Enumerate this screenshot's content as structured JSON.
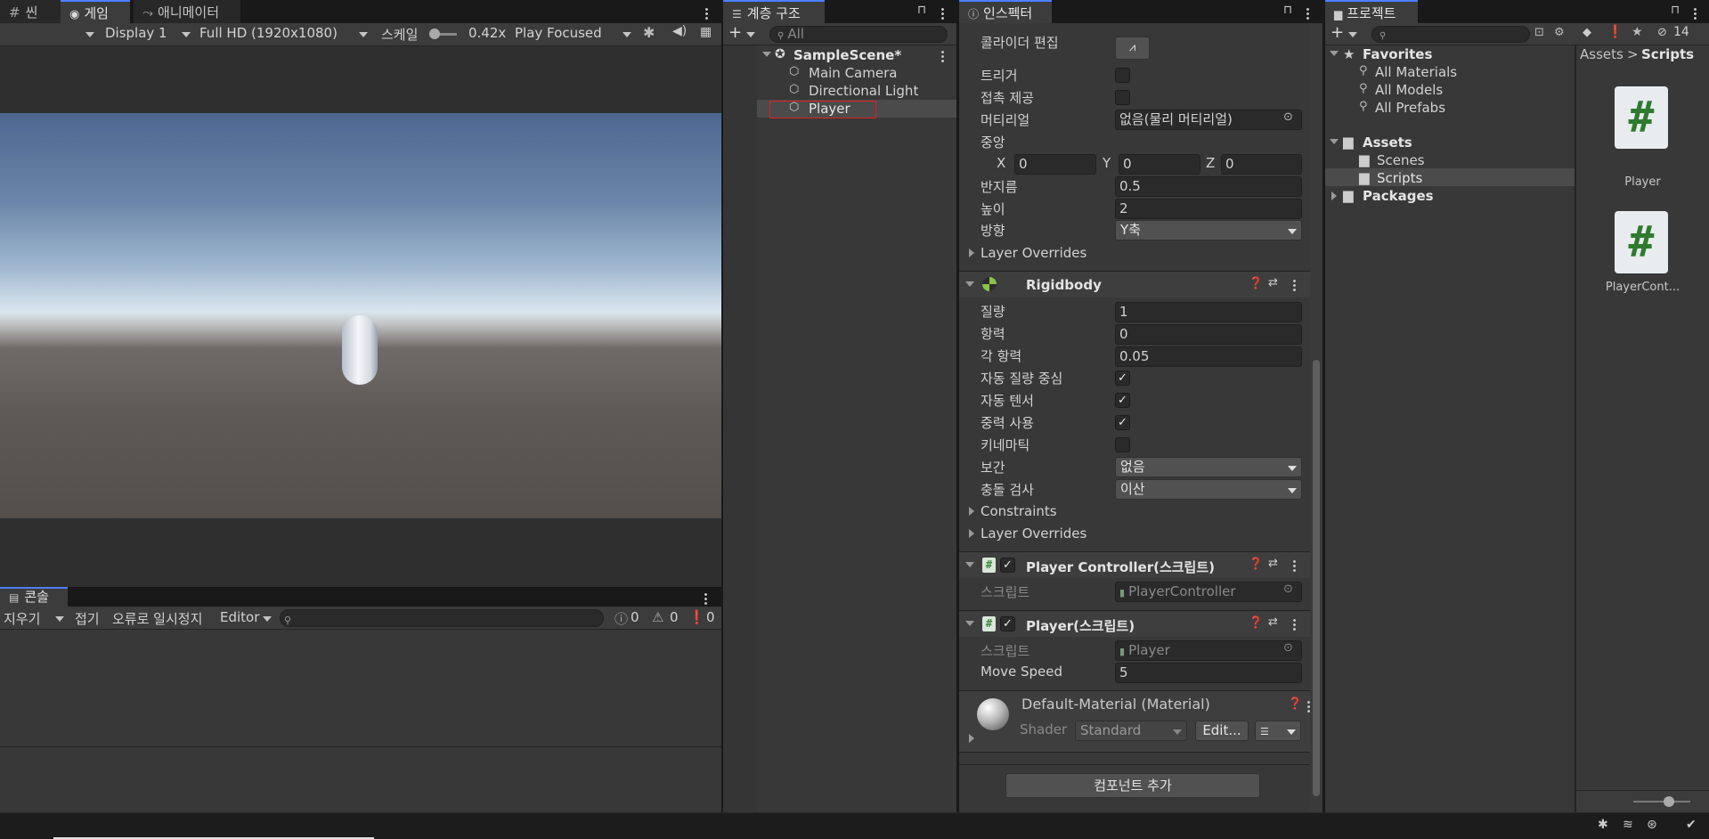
{
  "game_panel": {
    "tabs": [
      "씬",
      "게임",
      "애니메이터"
    ],
    "display": "Display 1",
    "resolution": "Full HD (1920x1080)",
    "scale_label": "스케일",
    "scale_value": "0.42x",
    "play_mode": "Play Focused"
  },
  "console_panel": {
    "tab": "콘솔",
    "clear": "지우기",
    "collapse": "접기",
    "error_pause": "오류로 일시정지",
    "editor": "Editor",
    "log_count": "0",
    "warn_count": "0",
    "error_count": "0"
  },
  "hierarchy": {
    "tab": "계층 구조",
    "search_placeholder": "All",
    "scene": "SampleScene*",
    "items": [
      "Main Camera",
      "Directional Light",
      "Player"
    ]
  },
  "inspector": {
    "tab": "인스펙터",
    "collider": {
      "edit_label": "콜라이더 편집",
      "trigger": "트리거",
      "contact": "접촉 제공",
      "material_label": "머티리얼",
      "material_value": "없음(물리 머티리얼)",
      "center_label": "중앙",
      "cx": "0",
      "cy": "0",
      "cz": "0",
      "radius_label": "반지름",
      "radius": "0.5",
      "height_label": "높이",
      "height": "2",
      "direction_label": "방향",
      "direction": "Y축",
      "layer_overrides": "Layer Overrides"
    },
    "rigidbody": {
      "title": "Rigidbody",
      "mass_label": "질량",
      "mass": "1",
      "drag_label": "항력",
      "drag": "0",
      "angular_drag_label": "각 항력",
      "angular_drag": "0.05",
      "auto_com": "자동 질량 중심",
      "auto_tensor": "자동 텐서",
      "use_gravity": "중력 사용",
      "kinematic": "키네마틱",
      "interp_label": "보간",
      "interp": "없음",
      "collision_label": "충돌 검사",
      "collision": "이산",
      "constraints": "Constraints",
      "layer_overrides": "Layer Overrides"
    },
    "player_controller": {
      "title": "Player Controller(스크립트)",
      "script_label": "스크립트",
      "script_value": "PlayerController"
    },
    "player_script": {
      "title": "Player(스크립트)",
      "script_label": "스크립트",
      "script_value": "Player",
      "speed_label": "Move Speed",
      "speed": "5"
    },
    "material": {
      "title": "Default-Material (Material)",
      "shader_label": "Shader",
      "shader": "Standard",
      "edit": "Edit..."
    },
    "add_component": "컴포넌트 추가"
  },
  "project": {
    "tab": "프로젝트",
    "favorites": "Favorites",
    "fav_items": [
      "All Materials",
      "All Models",
      "All Prefabs"
    ],
    "assets": "Assets",
    "asset_folders": [
      "Scenes",
      "Scripts"
    ],
    "packages": "Packages",
    "breadcrumb_root": "Assets",
    "breadcrumb_current": "Scripts",
    "files": [
      "Player",
      "PlayerCont..."
    ],
    "hidden_count": "14"
  }
}
